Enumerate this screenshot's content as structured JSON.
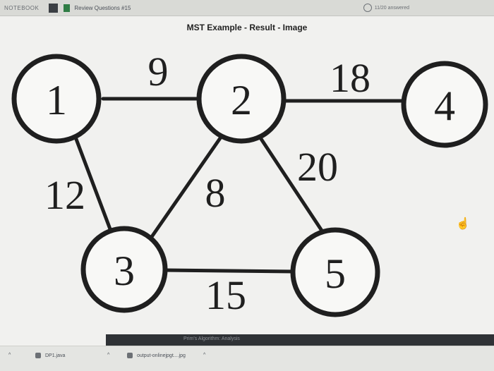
{
  "topbar": {
    "notebook_label": "NOTEBOOK",
    "tab_title": "Review Questions #15",
    "progress_text": "11/20 answered"
  },
  "page": {
    "title": "MST Example - Result - Image"
  },
  "graph": {
    "nodes": [
      {
        "id": "1",
        "label": "1"
      },
      {
        "id": "2",
        "label": "2"
      },
      {
        "id": "3",
        "label": "3"
      },
      {
        "id": "4",
        "label": "4"
      },
      {
        "id": "5",
        "label": "5"
      }
    ],
    "edges": [
      {
        "from": "1",
        "to": "2",
        "weight": "9"
      },
      {
        "from": "2",
        "to": "4",
        "weight": "18"
      },
      {
        "from": "1",
        "to": "3",
        "weight": "12"
      },
      {
        "from": "2",
        "to": "3",
        "weight": "8"
      },
      {
        "from": "2",
        "to": "5",
        "weight": "20"
      },
      {
        "from": "3",
        "to": "5",
        "weight": "15"
      }
    ]
  },
  "taskbar": {
    "strip_text": "Prim's Algorithm: Analysis",
    "items": [
      {
        "label": "DP1.java"
      },
      {
        "label": "output-onlinejpgt....jpg"
      }
    ],
    "chevron": "^"
  }
}
